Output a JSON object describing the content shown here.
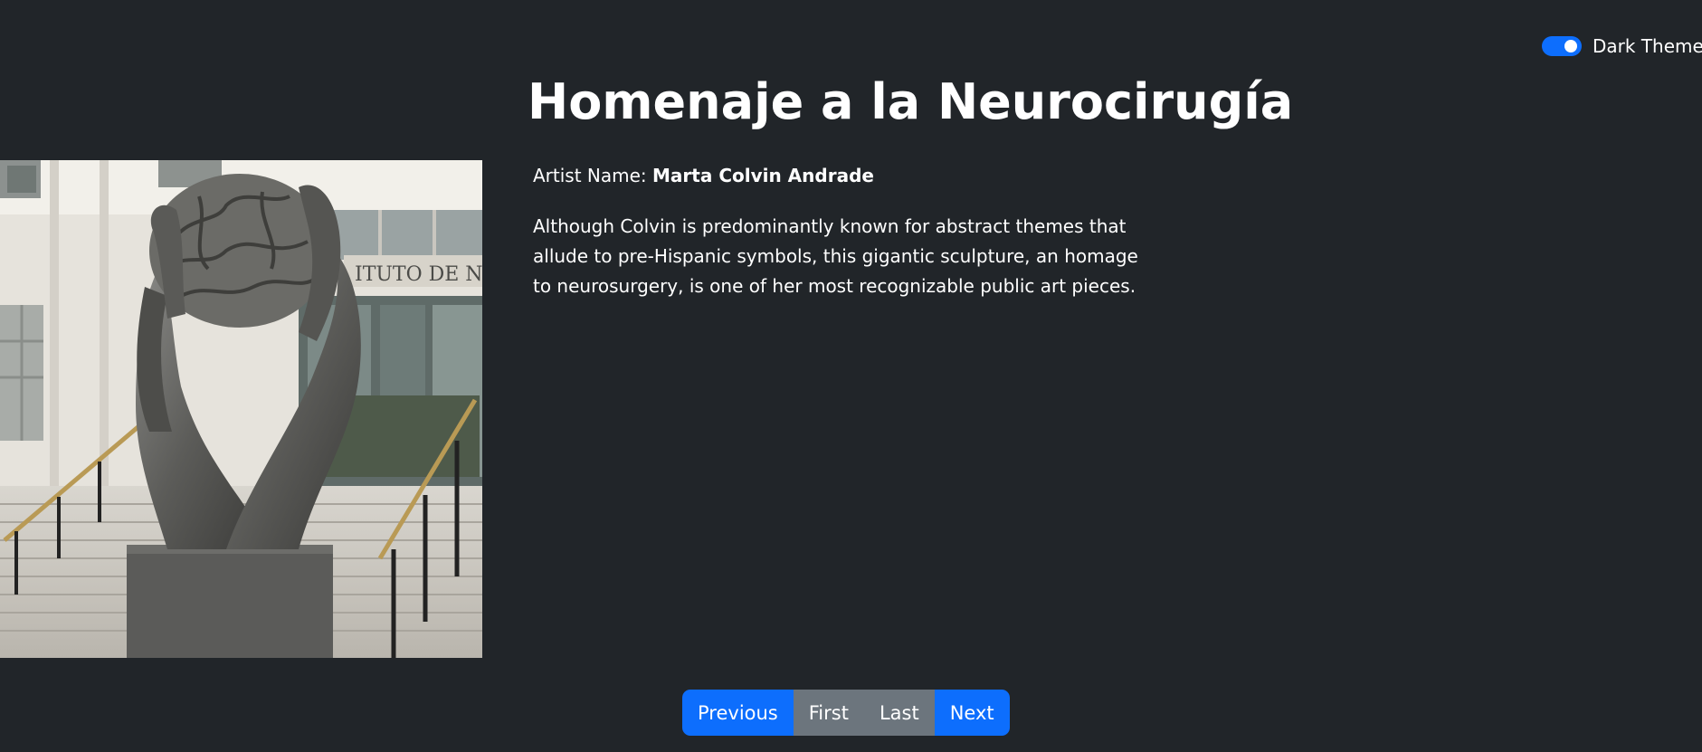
{
  "theme_toggle": {
    "label": "Dark Theme",
    "checked": true,
    "accent_color": "#0d6efd"
  },
  "artwork": {
    "title": "Homenaje a la Neurocirugía",
    "artist_label": "Artist Name: ",
    "artist_name": "Marta Colvin Andrade",
    "description": "Although Colvin is predominantly known for abstract themes that allude to pre-Hispanic symbols, this gigantic sculpture, an homage to neurosurgery, is one of her most recognizable public art pieces.",
    "building_sign": "ITUTO DE NE"
  },
  "pagination": {
    "previous": "Previous",
    "first": "First",
    "last": "Last",
    "next": "Next",
    "primary_color": "#0d6efd",
    "secondary_color": "#6c757d"
  },
  "colors": {
    "background": "#212529",
    "text": "#ffffff"
  }
}
